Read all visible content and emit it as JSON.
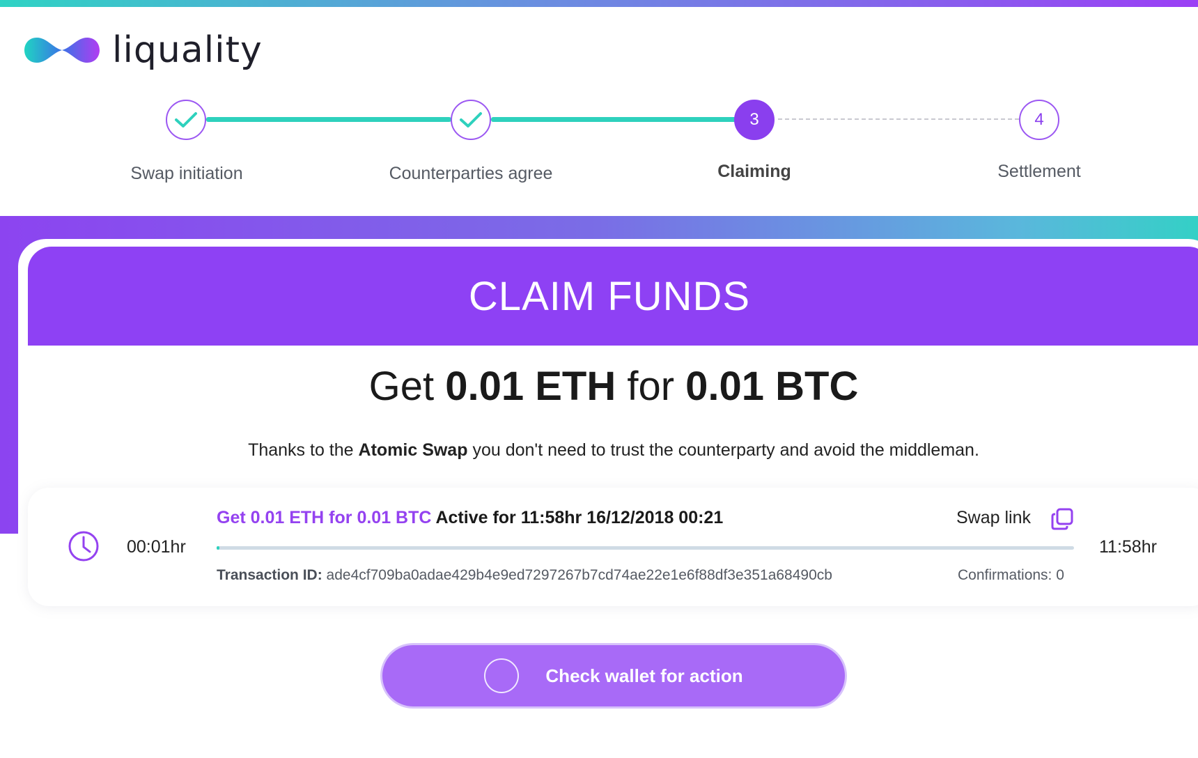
{
  "app": {
    "name": "liquality"
  },
  "stepper": {
    "steps": [
      {
        "label": "Swap initiation",
        "state": "done",
        "icon": "check-icon"
      },
      {
        "label": "Counterparties agree",
        "state": "done",
        "icon": "check-icon"
      },
      {
        "label": "Claiming",
        "state": "active",
        "number": "3"
      },
      {
        "label": "Settlement",
        "state": "pending",
        "number": "4"
      }
    ]
  },
  "claim": {
    "header": "CLAIM FUNDS",
    "headline_prefix": "Get",
    "headline_get_amount": "0.01 ETH",
    "headline_for": "for",
    "headline_give_amount": "0.01 BTC",
    "subtext_prefix": "Thanks to the",
    "subtext_bold": "Atomic Swap",
    "subtext_suffix": "you don't need to trust the counterparty and avoid the middleman."
  },
  "transaction": {
    "elapsed": "00:01hr",
    "remaining": "11:58hr",
    "title_accent": "Get 0.01 ETH for 0.01 BTC",
    "title_rest": "Active for 11:58hr 16/12/2018 00:21",
    "swap_link_label": "Swap link",
    "progress": 0.002,
    "tx_id_label": "Transaction ID:",
    "tx_id": "ade4cf709ba0adae429b4e9ed7297267b7cd74ae22e1e6f88df3e351a68490cb",
    "confirmations": "Confirmations: 0"
  },
  "action": {
    "label": "Check wallet for action"
  },
  "colors": {
    "brand_purple": "#8e41f4",
    "accent_teal": "#2ed1bd",
    "button": "#a86af7"
  }
}
